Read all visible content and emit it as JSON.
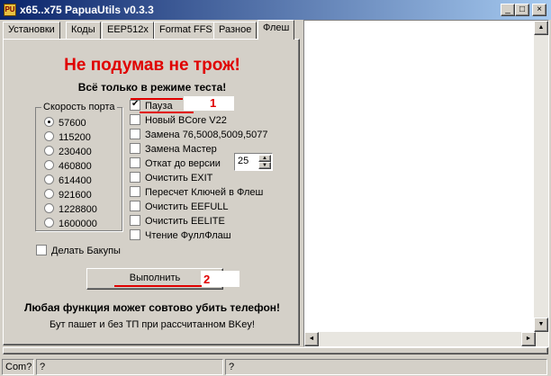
{
  "window": {
    "title": "x65..x75 PapuaUtils v0.3.3",
    "icon_text": "PU",
    "buttons": {
      "minimize": "_",
      "maximize": "□",
      "close": "×"
    }
  },
  "tabs": [
    "Установки",
    "Коды",
    "EEP512x",
    "Format FFS",
    "Разное",
    "Флеш"
  ],
  "active_tab": "Флеш",
  "panel": {
    "headline": "Не подумав не трож!",
    "subheadline": "Всё только в режиме теста!",
    "port_group": {
      "label": "Скорость порта",
      "options": [
        "57600",
        "115200",
        "230400",
        "460800",
        "614400",
        "921600",
        "1228800",
        "1600000"
      ],
      "selected": "57600"
    },
    "checkboxes": [
      {
        "label": "Пауза",
        "checked": true
      },
      {
        "label": "Новый BCore V22",
        "checked": false
      },
      {
        "label": "Замена 76,5008,5009,5077",
        "checked": false
      },
      {
        "label": "Замена Мастер",
        "checked": false
      },
      {
        "label": "Откат до версии",
        "checked": false
      },
      {
        "label": "Очистить EXIT",
        "checked": false
      },
      {
        "label": "Пересчет Ключей в Флеш",
        "checked": false
      },
      {
        "label": "Очистить EEFULL",
        "checked": false
      },
      {
        "label": "Очистить EELITE",
        "checked": false
      },
      {
        "label": "Чтение ФуллФлаш",
        "checked": false
      }
    ],
    "version_spinner": {
      "value": "25",
      "up": "▲",
      "down": "▼"
    },
    "backup_checkbox": {
      "label": "Делать Бакупы",
      "checked": false
    },
    "run_button": "Выполнить",
    "warning": "Любая функция может совтово убить телефон!",
    "note": "Бут пашет и без ТП при рассчитанном BKey!",
    "annotations": [
      "1",
      "2"
    ],
    "annotation_color": "#e00000"
  },
  "scrollbars": {
    "up": "▲",
    "down": "▼",
    "left": "◄",
    "right": "►"
  },
  "statusbar": [
    "Com?",
    "?",
    "?"
  ],
  "colors": {
    "titlebar": "#0a246a",
    "headline": "#e00000",
    "face": "#d4d0c8"
  }
}
